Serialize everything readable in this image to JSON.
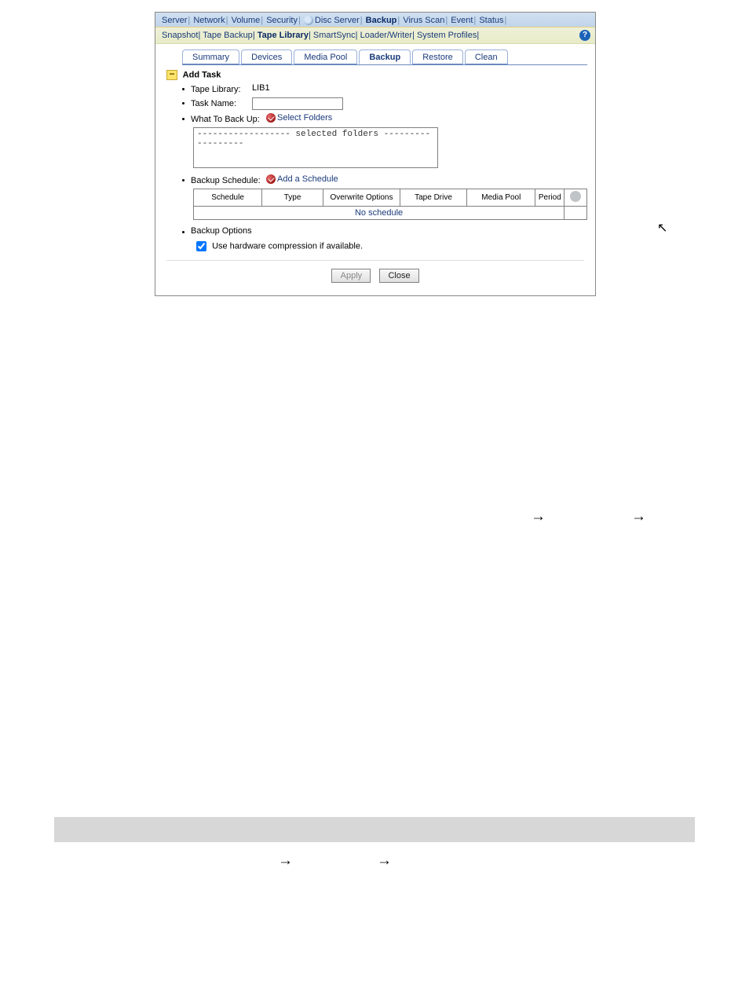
{
  "mainTabs": {
    "items": [
      "Server",
      "Network",
      "Volume",
      "Security",
      "Disc Server",
      "Backup",
      "Virus Scan",
      "Event",
      "Status"
    ],
    "activeIndex": 5
  },
  "subTabs": {
    "items": [
      "Snapshot",
      "Tape Backup",
      "Tape Library",
      "SmartSync",
      "Loader/Writer",
      "System Profiles"
    ],
    "activeIndex": 2
  },
  "pageTabs": {
    "items": [
      "Summary",
      "Devices",
      "Media Pool",
      "Backup",
      "Restore",
      "Clean"
    ],
    "activeIndex": 3
  },
  "section": {
    "title": "Add Task"
  },
  "fields": {
    "tapeLibraryLabel": "Tape Library:",
    "tapeLibraryValue": "LIB1",
    "taskNameLabel": "Task Name:",
    "taskNameValue": "",
    "whatToBackUpLabel": "What To Back Up:",
    "selectFoldersLink": "Select Folders",
    "selectedFoldersBanner": "------------------ selected folders ------------------",
    "backupScheduleLabel": "Backup Schedule:",
    "addScheduleLink": "Add a Schedule",
    "backupOptionsLabel": "Backup Options",
    "compressionLabel": "Use hardware compression if available.",
    "compressionChecked": true
  },
  "scheduleTable": {
    "headers": [
      "Schedule",
      "Type",
      "Overwrite Options",
      "Tape Drive",
      "Media Pool",
      "Period"
    ],
    "noScheduleText": "No schedule"
  },
  "buttons": {
    "apply": "Apply",
    "close": "Close"
  }
}
